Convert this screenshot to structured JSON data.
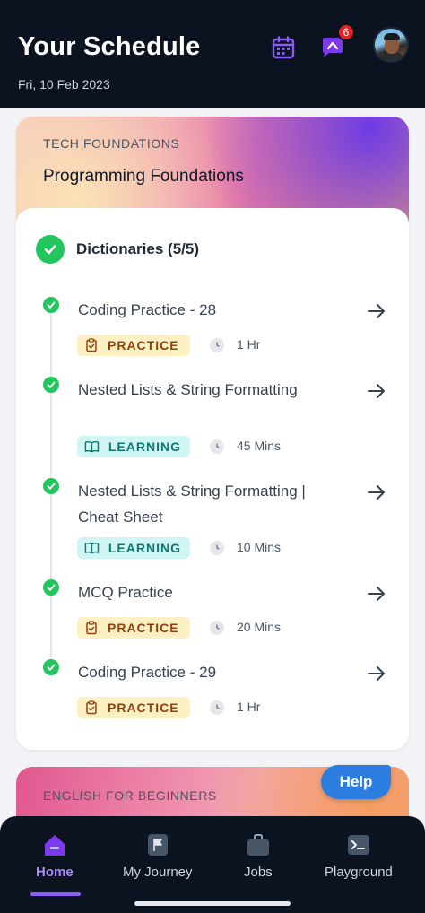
{
  "header": {
    "title": "Your Schedule",
    "date": "Fri, 10 Feb 2023",
    "notification_count": "6",
    "calendar_icon": "calendar-icon",
    "chat_icon": "chat-icon"
  },
  "course": {
    "subtitle": "TECH FOUNDATIONS",
    "title": "Programming Foundations",
    "topic": "Dictionaries (5/5)",
    "items": [
      {
        "name": "Coding Practice - 28",
        "tag": "PRACTICE",
        "duration": "1 Hr"
      },
      {
        "name": "Nested Lists & String Formatting",
        "tag": "LEARNING",
        "duration": "45 Mins"
      },
      {
        "name": "Nested Lists & String Formatting | Cheat Sheet",
        "tag": "LEARNING",
        "duration": "10 Mins"
      },
      {
        "name": "MCQ Practice",
        "tag": "PRACTICE",
        "duration": "20 Mins"
      },
      {
        "name": "Coding Practice - 29",
        "tag": "PRACTICE",
        "duration": "1 Hr"
      }
    ]
  },
  "next_course": {
    "subtitle": "ENGLISH FOR BEGINNERS"
  },
  "help_label": "Help",
  "nav": {
    "home": "Home",
    "journey": "My Journey",
    "jobs": "Jobs",
    "playground": "Playground"
  },
  "colors": {
    "header_bg": "#0b1220",
    "success": "#22c55e",
    "accent": "#8b5cf6",
    "help": "#2b7de0"
  }
}
